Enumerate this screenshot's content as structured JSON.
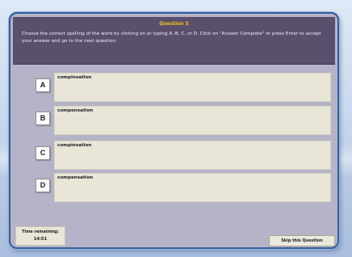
{
  "question": {
    "title": "Question 5",
    "instructions": "Choose the correct spelling of the word by clicking on or typing A, B, C, or D.  Click on \"Answer Complete\" or press Enter to accept your answer and go to the next question."
  },
  "options": [
    {
      "letter": "A",
      "text": "compinsation"
    },
    {
      "letter": "B",
      "text": "compensation"
    },
    {
      "letter": "C",
      "text": "compinsation"
    },
    {
      "letter": "D",
      "text": "compensation"
    }
  ],
  "timer": {
    "label": "Time remaining:",
    "value": "14:51"
  },
  "skip": {
    "label": "Skip this Question"
  },
  "colors": {
    "title_accent": "#f2c21b",
    "instruction_panel": "#5a4f6d",
    "window_body": "#b5b3c7",
    "option_fill": "#e9e6d8",
    "window_border": "#2f5f9e"
  }
}
